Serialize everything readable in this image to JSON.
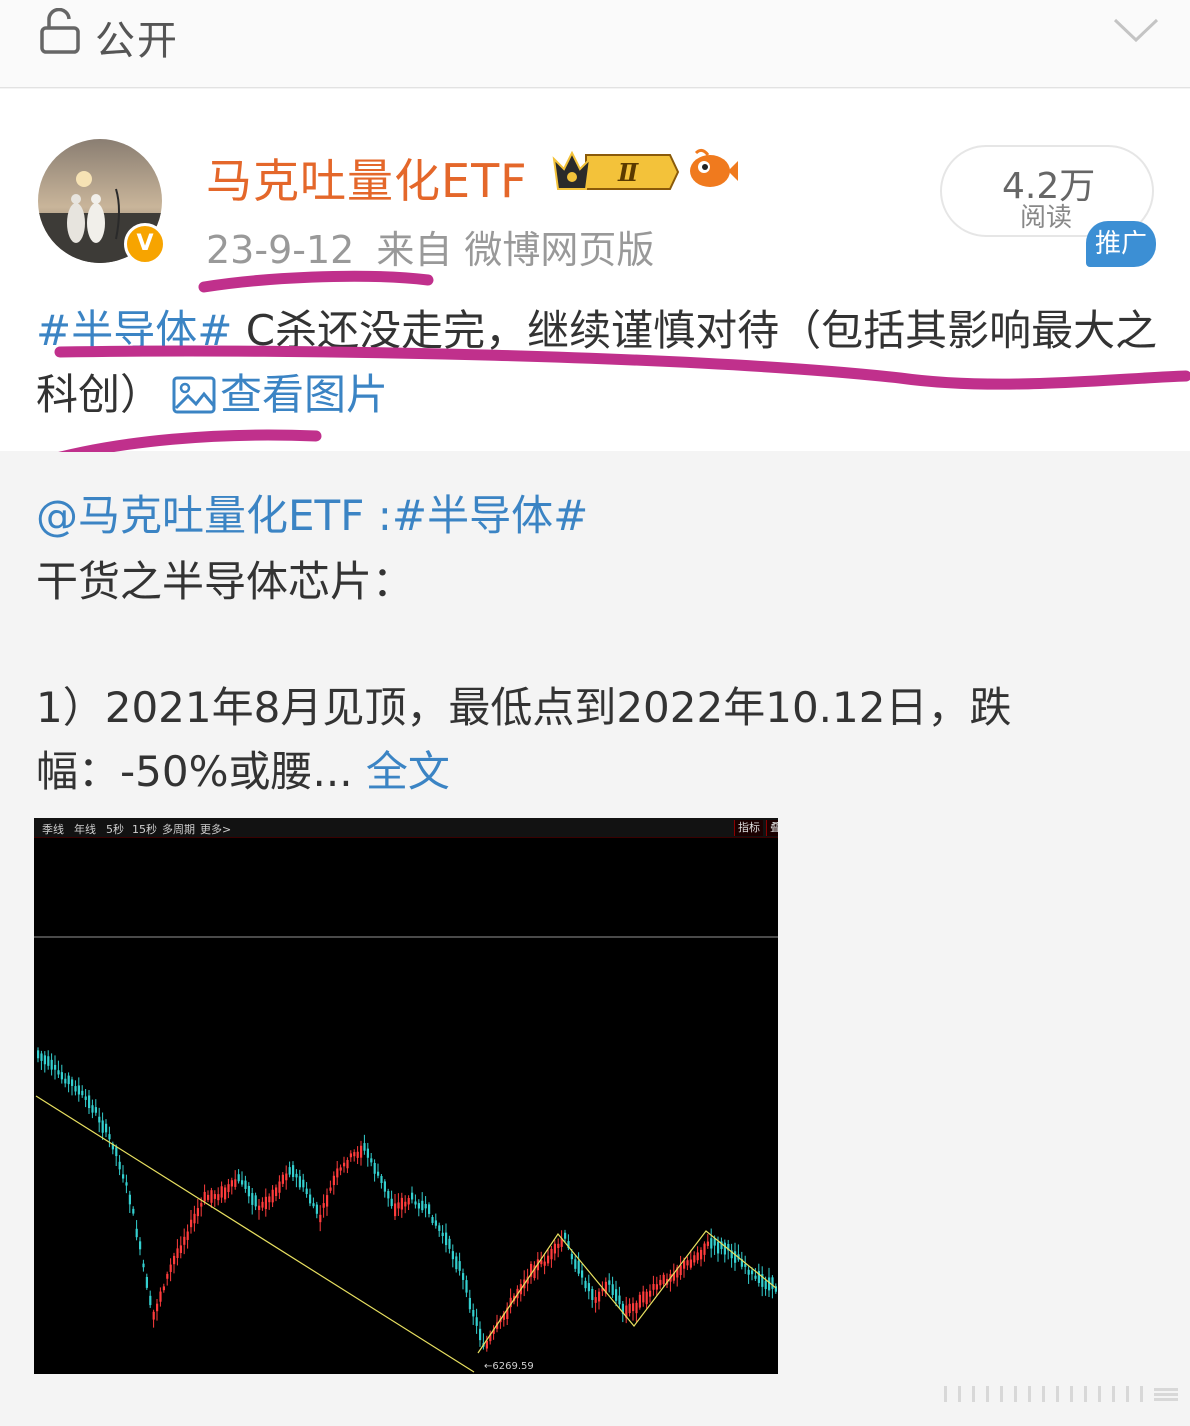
{
  "topbar": {
    "privacy_label": "公开",
    "icons": {
      "lock": "lock-icon",
      "expand": "chevron-down-icon"
    }
  },
  "post": {
    "username": "马克吐量化ETF",
    "user_level_badge": "Ⅱ",
    "verified_badge_label": "V",
    "date": "23-9-12",
    "source": "来自 微博网页版",
    "read_count": "4.2万",
    "read_label": "阅读",
    "promo_badge": "推广",
    "hashtag": "#半导体#",
    "text_part1": " C杀还没走完，继续谨慎对待（包括其影响最大之科创）",
    "view_images": "查看图片",
    "accent_color": "#e4672a",
    "link_color": "#3b84c4",
    "annotation_color": "#c0308c"
  },
  "repost": {
    "mention": "@马克吐量化ETF",
    "separator": " :",
    "hashtag": "#半导体#",
    "line1": "干货之半导体芯片：",
    "line2": "1）2021年8月见顶，最低点到2022年10.12日，跌",
    "line3": "幅：-50%或腰... ",
    "full_text": "全文"
  },
  "chart_image": {
    "toolbar_items": [
      "季线",
      "年线",
      "5秒",
      "15秒",
      "多周期",
      "更多>"
    ],
    "toolbar_right": [
      "指标",
      "叠"
    ],
    "low_label": "←6269.59",
    "up_color": "#ff3c3c",
    "down_color": "#34d0d0",
    "trendline_color": "#e8e060"
  }
}
